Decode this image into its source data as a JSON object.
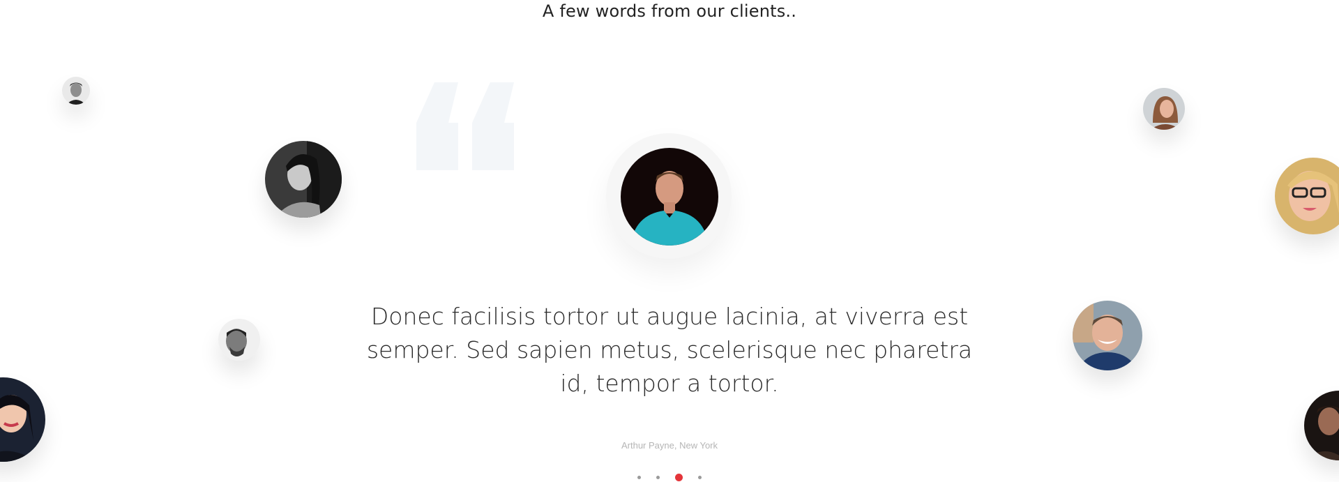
{
  "section": {
    "heading": "A few words from our clients.."
  },
  "testimonial": {
    "quote": "Donec facilisis tortor ut augue lacinia, at viverra est semper. Sed sapien metus, scelerisque nec pharetra id, tempor a tortor.",
    "author": "Arthur Payne, New York"
  },
  "carousel": {
    "slide_count": 4,
    "active_index": 2,
    "active_color": "#e4353a",
    "inactive_color": "#9a9a9a"
  },
  "quote_mark_color": "#f3f6f9",
  "avatars": [
    "client-avatar-top-left",
    "client-avatar-left-upper",
    "client-avatar-center-featured",
    "client-avatar-top-right",
    "client-avatar-right-edge",
    "client-avatar-left-lower",
    "client-avatar-right-lower",
    "client-avatar-bottom-left",
    "client-avatar-bottom-right"
  ]
}
